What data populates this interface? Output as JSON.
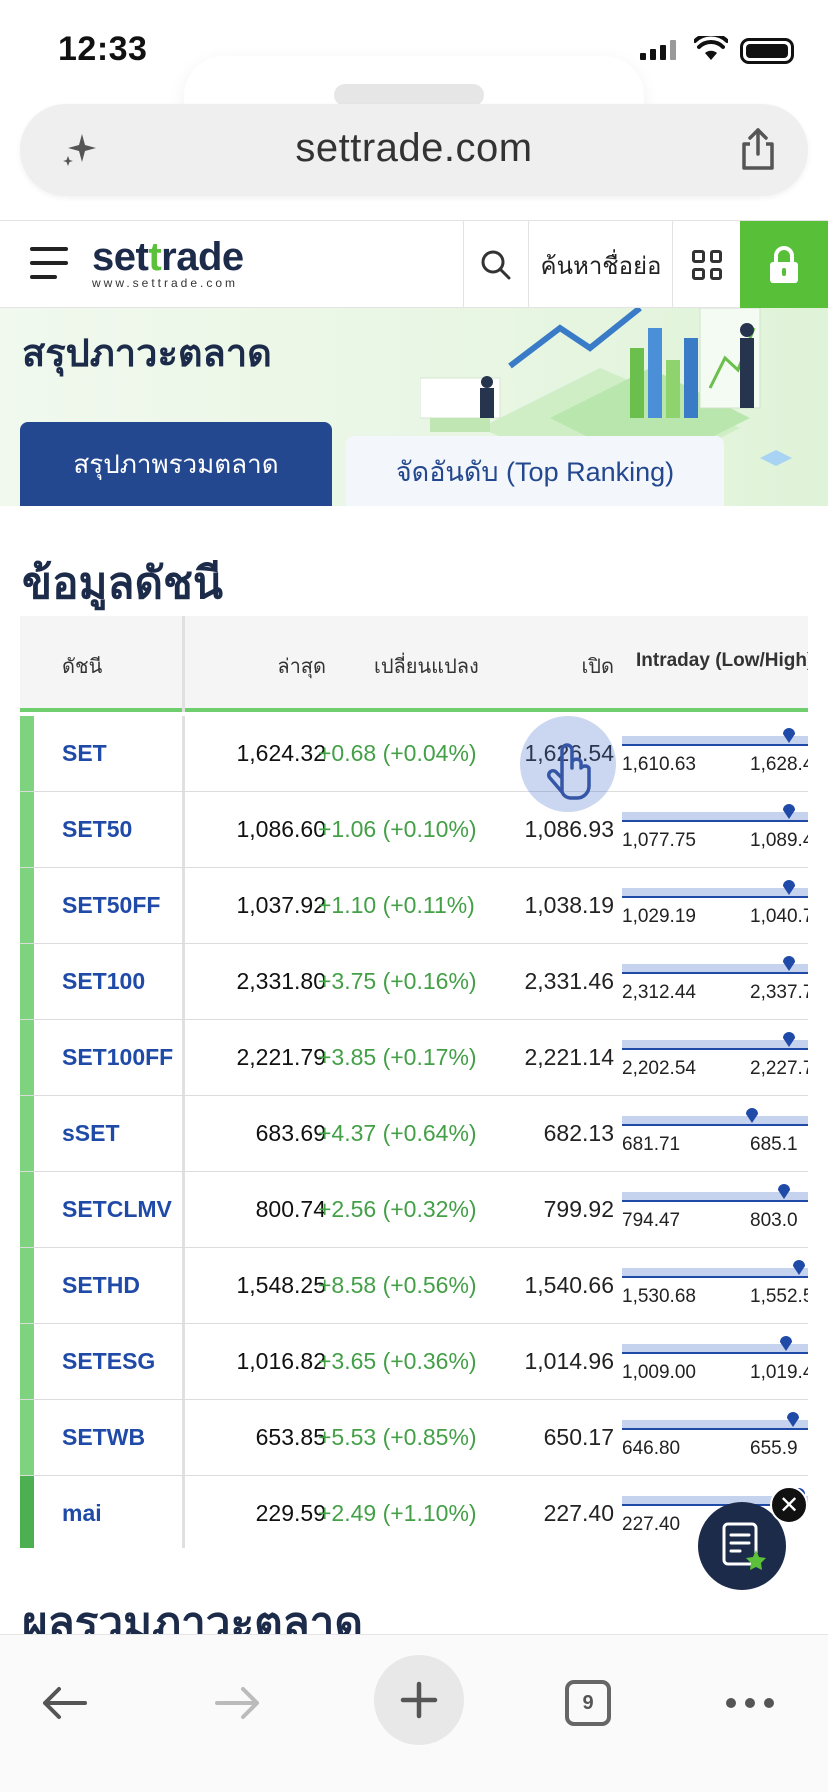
{
  "status_bar": {
    "time": "12:33"
  },
  "browser": {
    "url": "settrade.com",
    "tab_count": "9"
  },
  "site_header": {
    "logo_text_a": "set",
    "logo_text_t": "t",
    "logo_text_b": "rade",
    "logo_sub": "www.settrade.com",
    "quick_search_label": "ค้นหาชื่อย่อ"
  },
  "banner": {
    "title": "สรุปภาวะตลาด",
    "tabs": [
      {
        "label": "สรุปภาพรวมตลาด",
        "active": true
      },
      {
        "label": "จัดอันดับ (Top Ranking)",
        "active": false
      }
    ]
  },
  "index_section": {
    "title": "ข้อมูลดัชนี",
    "columns": [
      "ดัชนี",
      "ล่าสุด",
      "เปลี่ยนแปลง",
      "เปิด",
      "Intraday (Low/High)"
    ],
    "rows": [
      {
        "name": "SET",
        "last": "1,624.32",
        "change": "+0.68 (+0.04%)",
        "open": "1,626.54",
        "low": "1,610.63",
        "high": "1,628.4",
        "level": 0.9
      },
      {
        "name": "SET50",
        "last": "1,086.60",
        "change": "+1.06 (+0.10%)",
        "open": "1,086.93",
        "low": "1,077.75",
        "high": "1,089.4",
        "level": 0.9
      },
      {
        "name": "SET50FF",
        "last": "1,037.92",
        "change": "+1.10 (+0.11%)",
        "open": "1,038.19",
        "low": "1,029.19",
        "high": "1,040.7",
        "level": 0.9
      },
      {
        "name": "SET100",
        "last": "2,331.80",
        "change": "+3.75 (+0.16%)",
        "open": "2,331.46",
        "low": "2,312.44",
        "high": "2,337.7",
        "level": 0.9
      },
      {
        "name": "SET100FF",
        "last": "2,221.79",
        "change": "+3.85 (+0.17%)",
        "open": "2,221.14",
        "low": "2,202.54",
        "high": "2,227.7",
        "level": 0.9
      },
      {
        "name": "sSET",
        "last": "683.69",
        "change": "+4.37 (+0.64%)",
        "open": "682.13",
        "low": "681.71",
        "high": "685.1",
        "level": 0.7
      },
      {
        "name": "SETCLMV",
        "last": "800.74",
        "change": "+2.56 (+0.32%)",
        "open": "799.92",
        "low": "794.47",
        "high": "803.0",
        "level": 0.87
      },
      {
        "name": "SETHD",
        "last": "1,548.25",
        "change": "+8.58 (+0.56%)",
        "open": "1,540.66",
        "low": "1,530.68",
        "high": "1,552.5",
        "level": 0.95
      },
      {
        "name": "SETESG",
        "last": "1,016.82",
        "change": "+3.65 (+0.36%)",
        "open": "1,014.96",
        "low": "1,009.00",
        "high": "1,019.4",
        "level": 0.88
      },
      {
        "name": "SETWB",
        "last": "653.85",
        "change": "+5.53 (+0.85%)",
        "open": "650.17",
        "low": "646.80",
        "high": "655.9",
        "level": 0.92
      },
      {
        "name": "mai",
        "last": "229.59",
        "change": "+2.49 (+1.10%)",
        "open": "227.40",
        "low": "227.40",
        "high": "2",
        "level": 0.95
      }
    ]
  },
  "market_section": {
    "title": "ผลรวมภาวะตลาด"
  },
  "colors": {
    "brand_navy": "#1c2b4a",
    "accent_green": "#58c038",
    "link_blue": "#1f4aa8",
    "up_green": "#43a047",
    "tab_blue": "#23488f"
  }
}
